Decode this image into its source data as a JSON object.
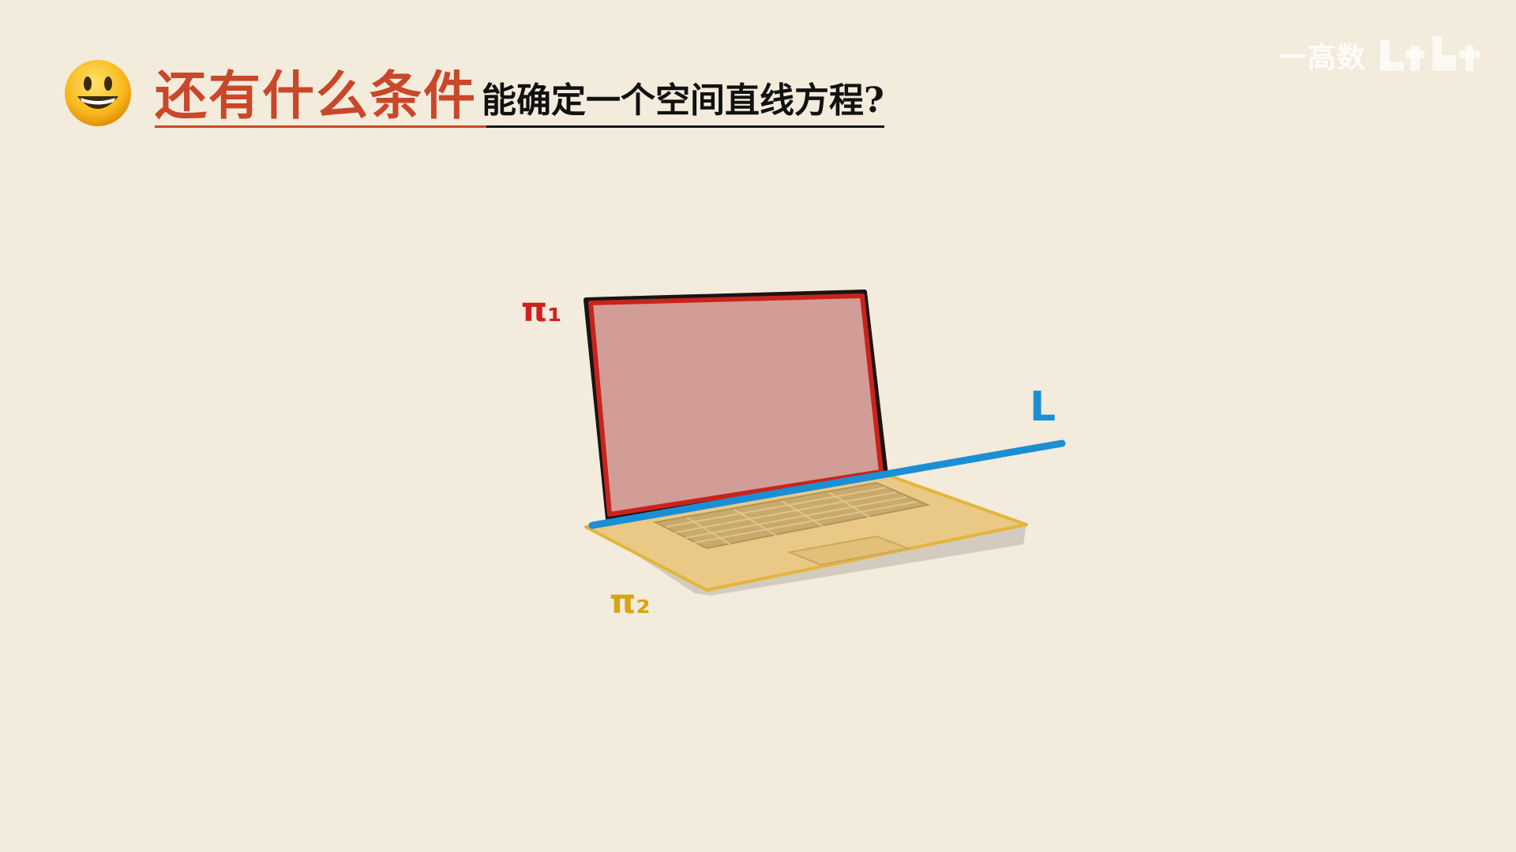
{
  "title": {
    "accent": "还有什么条件",
    "rest": "能确定一个空间直线方程?"
  },
  "watermark": {
    "text": "一高数"
  },
  "labels": {
    "plane1": "π₁",
    "plane2": "π₂",
    "line": "L"
  },
  "icons": {
    "title_icon": "smiley-face-icon",
    "watermark_logo": "brand-logo-icon"
  },
  "colors": {
    "background": "#f3ebdb",
    "title_accent": "#c9472a",
    "plane1": "#d21f1f",
    "plane2": "#d6a516",
    "line": "#1b8fd6"
  }
}
